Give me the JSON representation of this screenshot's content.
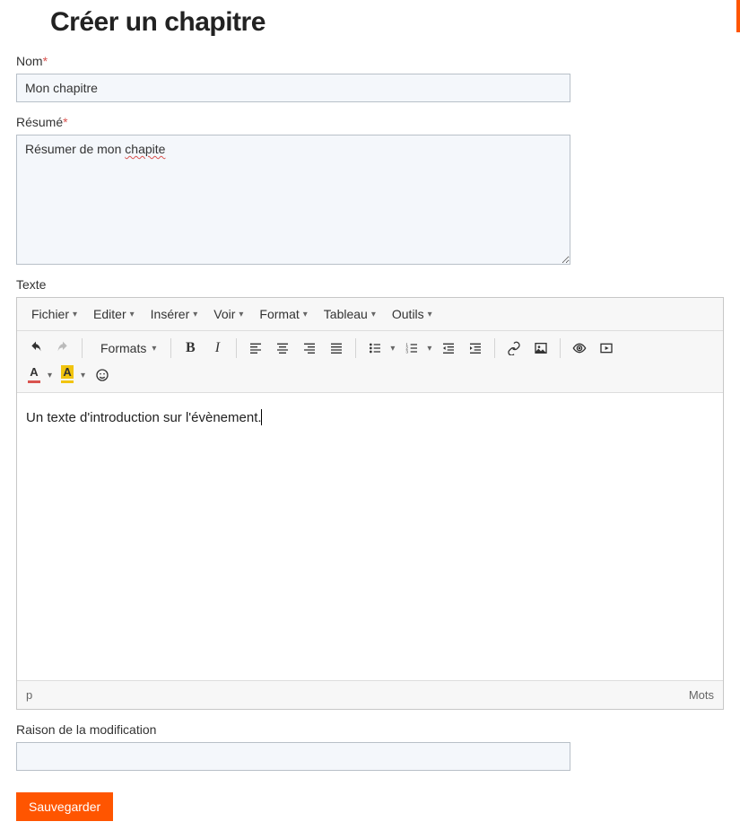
{
  "page": {
    "title": "Créer un chapitre"
  },
  "fields": {
    "name": {
      "label": "Nom",
      "value": "Mon chapitre"
    },
    "summary": {
      "label": "Résumé",
      "value_prefix": "Résumer de mon ",
      "value_err": "chapite"
    },
    "text": {
      "label": "Texte"
    },
    "reason": {
      "label": "Raison de la modification",
      "value": ""
    }
  },
  "editor": {
    "menubar": [
      "Fichier",
      "Editer",
      "Insérer",
      "Voir",
      "Format",
      "Tableau",
      "Outils"
    ],
    "formats_label": "Formats",
    "content": "Un texte d'introduction sur l'évènement.",
    "status_path": "p",
    "status_words": "Mots"
  },
  "actions": {
    "save": "Sauvegarder"
  },
  "colors": {
    "text_color": "#d9534f",
    "bg_color": "#f1c40f"
  }
}
